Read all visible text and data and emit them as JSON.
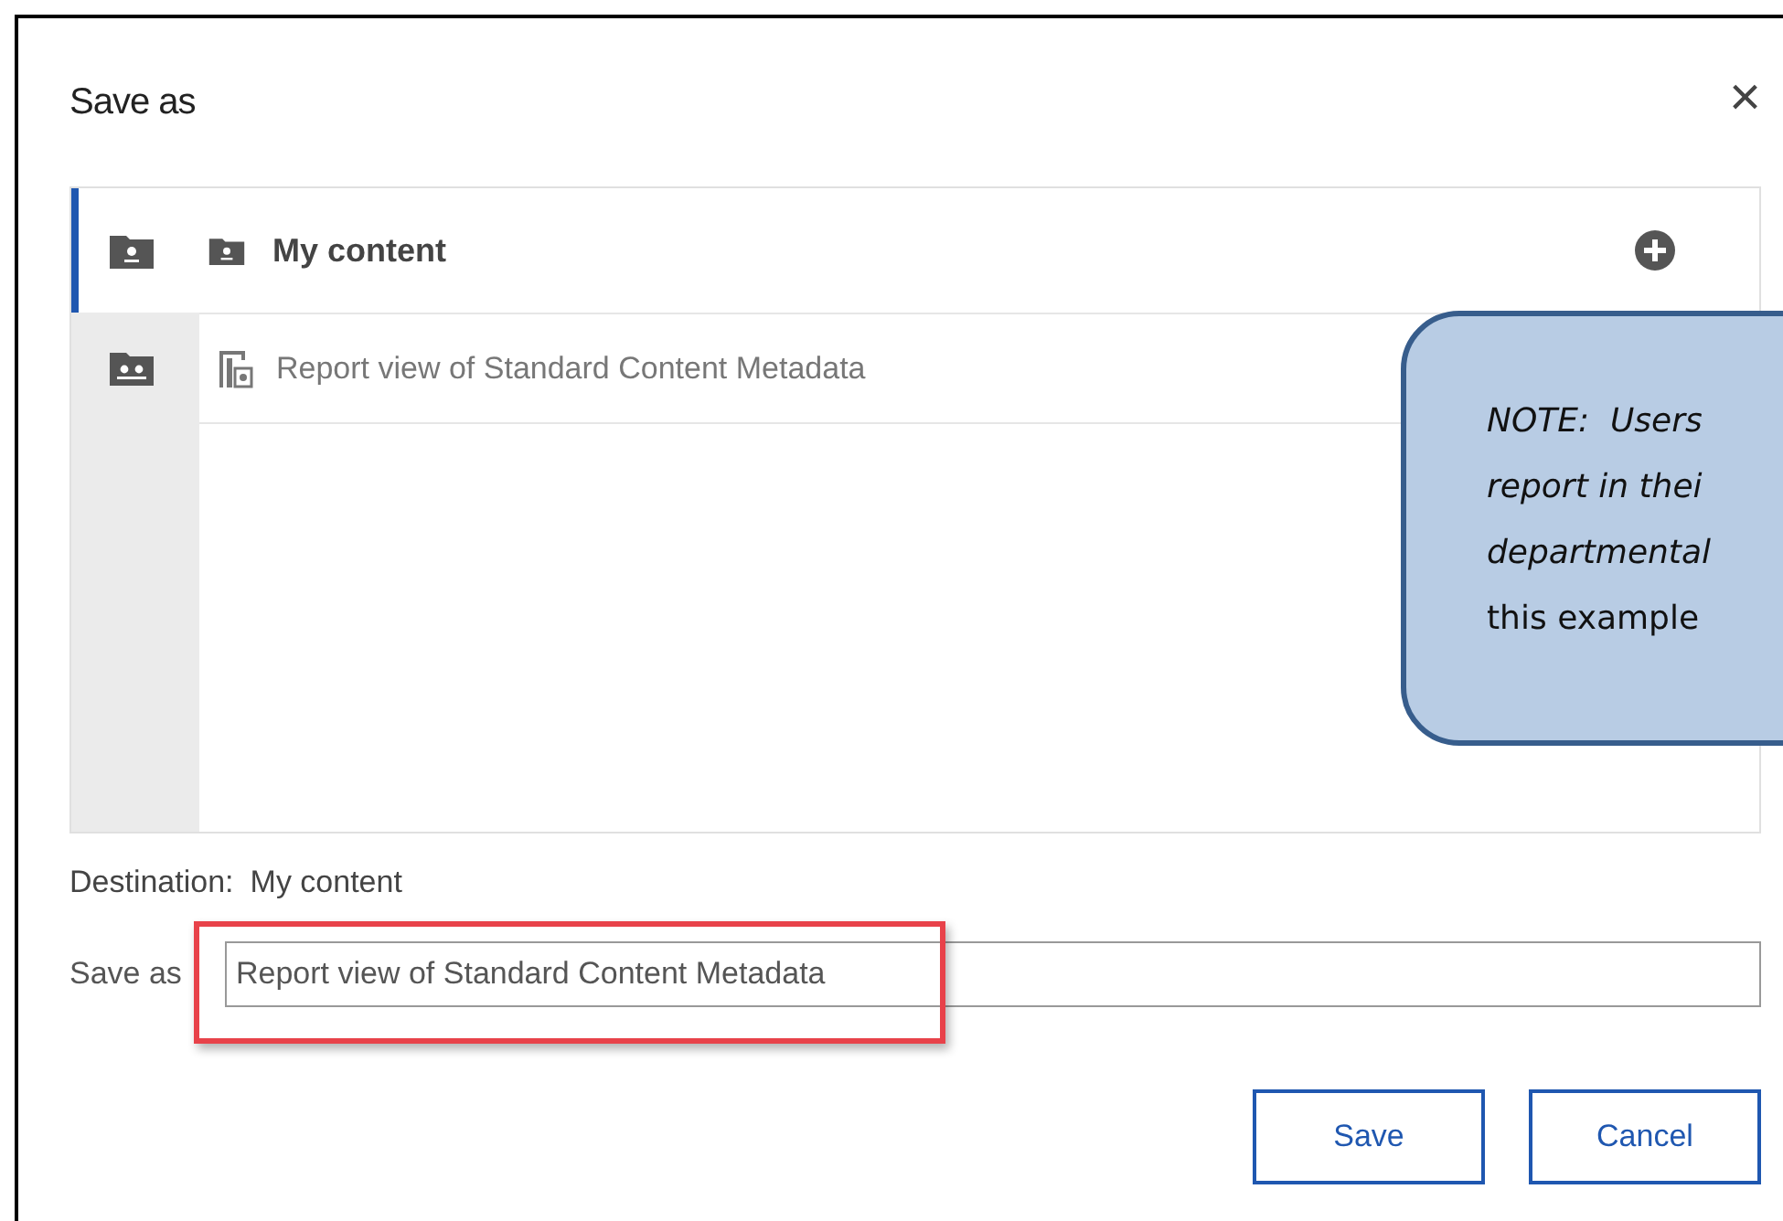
{
  "dialog": {
    "title": "Save as",
    "close": "×"
  },
  "rail": [
    {
      "kind": "personal",
      "selected": true
    },
    {
      "kind": "team",
      "selected": false
    }
  ],
  "tree": {
    "root": {
      "label": "My content",
      "add": true
    },
    "items": [
      {
        "label": "Report view of Standard Content Metadata"
      }
    ]
  },
  "destination": {
    "label": "Destination:",
    "value": "My content"
  },
  "save_as": {
    "label": "Save as",
    "value": "Report view of Standard Content Metadata",
    "highlighted": true
  },
  "buttons": [
    {
      "label": "Save"
    },
    {
      "label": "Cancel"
    }
  ],
  "note": {
    "lines": [
      {
        "text": "NOTE:  Users",
        "italic": true
      },
      {
        "text": "report in thei",
        "italic": true
      },
      {
        "text": "departmental",
        "italic": true
      },
      {
        "text": "this example",
        "italic": false
      }
    ]
  }
}
